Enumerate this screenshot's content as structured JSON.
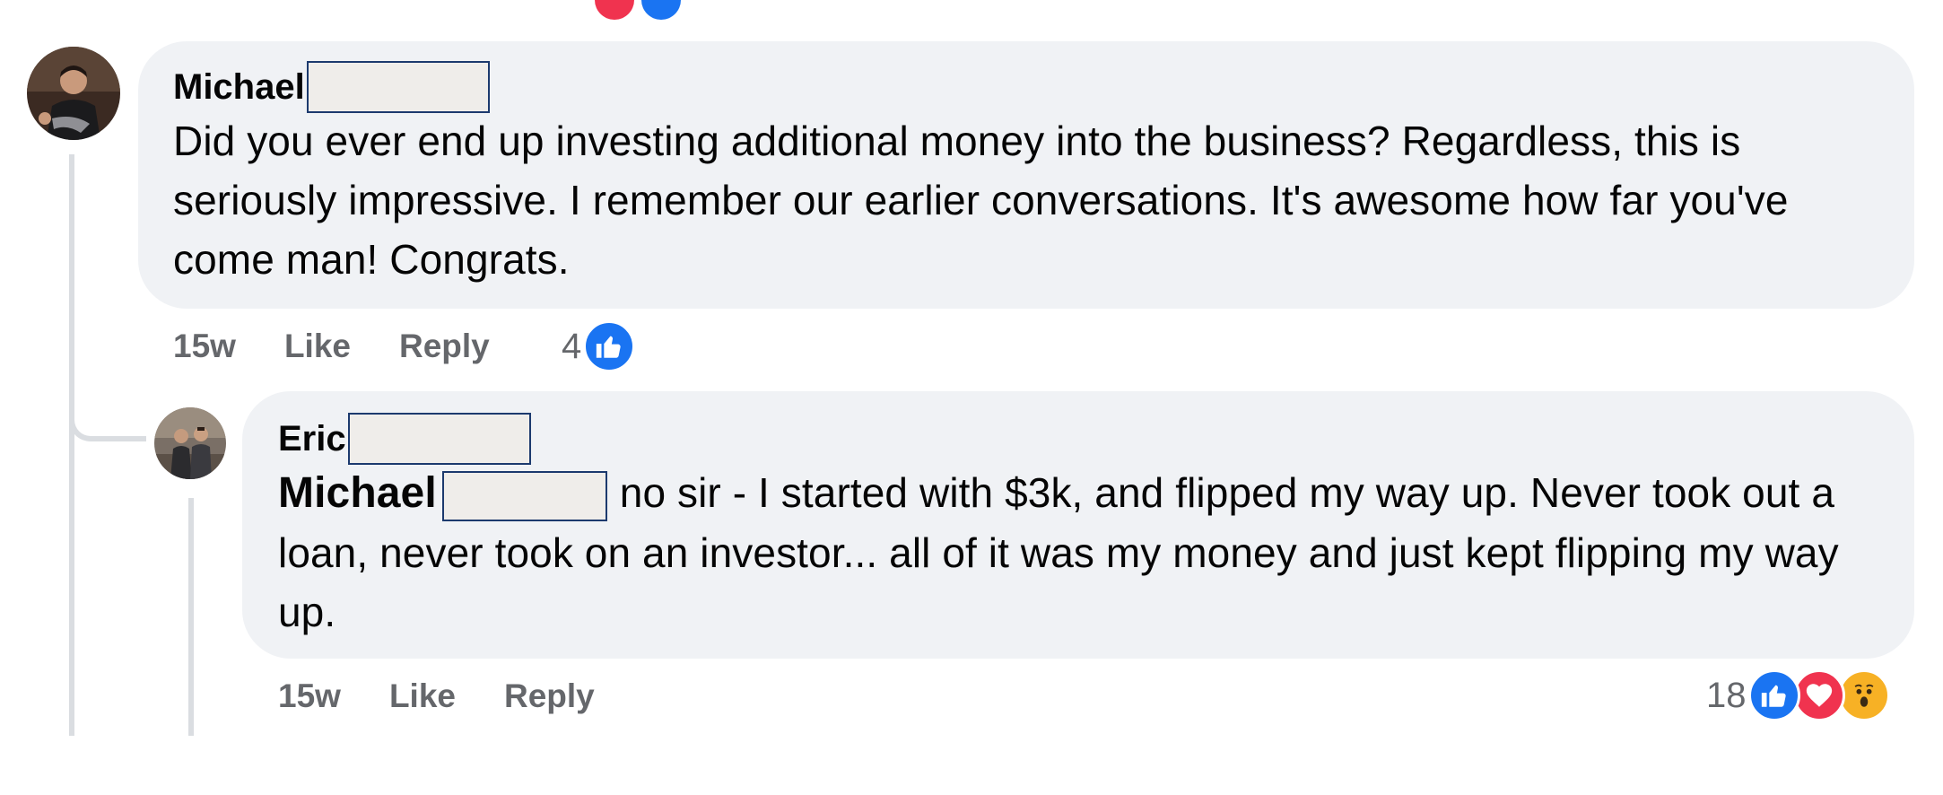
{
  "comments": [
    {
      "author": "Michael",
      "text": "Did you ever end up investing additional money into the business? Regardless, this is seriously impressive. I remember our earlier conversations. It's awesome how far you've come man! Congrats.",
      "time": "15w",
      "like_label": "Like",
      "reply_label": "Reply",
      "reaction_count": "4",
      "reactions": [
        "like-icon"
      ]
    },
    {
      "author": "Eric",
      "mention": "Michael",
      "text": "no sir - I started with $3k, and flipped my way up. Never took out a loan, never took on an investor... all of it was my money and just kept flipping my way up.",
      "time": "15w",
      "like_label": "Like",
      "reply_label": "Reply",
      "reaction_count": "18",
      "reactions": [
        "like-icon",
        "love-icon",
        "wow-icon"
      ]
    }
  ],
  "colors": {
    "bubble": "#f0f2f5",
    "like_blue": "#1a74f2",
    "love_red": "#f0334f",
    "wow_yellow": "#f7b125",
    "meta_gray": "#65676b",
    "thread_line": "#dadde1"
  }
}
